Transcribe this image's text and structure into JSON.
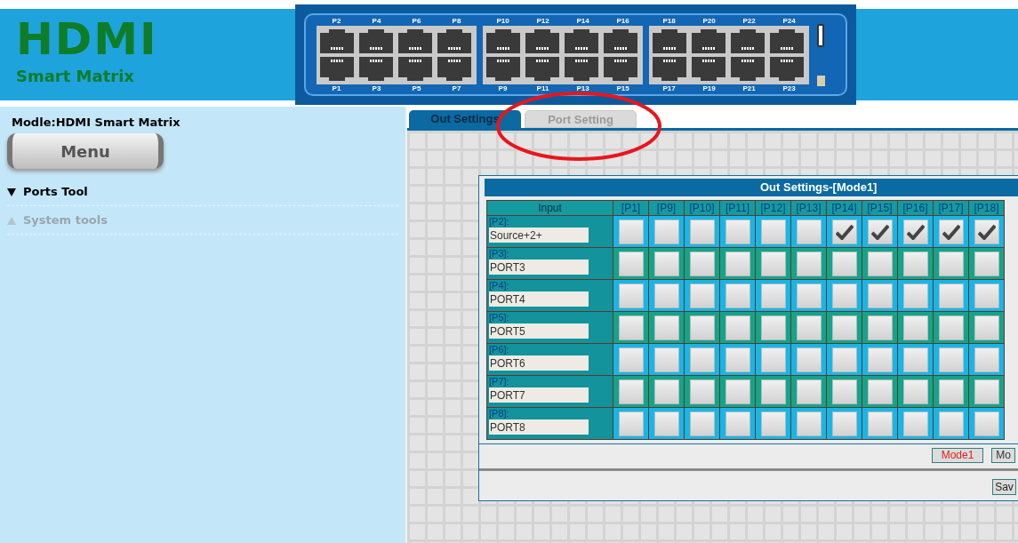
{
  "logo": {
    "title": "HDMI",
    "subtitle": "Smart Matrix"
  },
  "switch_panel": {
    "groups": [
      {
        "top_labels": [
          "P2",
          "P4",
          "P6",
          "P8"
        ],
        "bottom_labels": [
          "P1",
          "P3",
          "P5",
          "P7"
        ]
      },
      {
        "top_labels": [
          "P10",
          "P12",
          "P14",
          "P16"
        ],
        "bottom_labels": [
          "P9",
          "P11",
          "P13",
          "P15"
        ]
      },
      {
        "top_labels": [
          "P18",
          "P20",
          "P22",
          "P24"
        ],
        "bottom_labels": [
          "P17",
          "P19",
          "P21",
          "P23"
        ]
      }
    ]
  },
  "sidebar": {
    "model": "Modle:HDMI Smart Matrix",
    "menu_button": "Menu",
    "items": [
      {
        "label": "Ports Tool",
        "expanded": true
      },
      {
        "label": "System tools",
        "expanded": false
      }
    ]
  },
  "tabs": [
    {
      "label": "Out Settings",
      "selected": true
    },
    {
      "label": "Port Setting",
      "selected": false
    }
  ],
  "panel": {
    "title": "Out Settings-[Mode1]",
    "columns": [
      "Input",
      "[P1]",
      "[P9]",
      "[P10]",
      "[P11]",
      "[P12]",
      "[P13]",
      "[P14]",
      "[P15]",
      "[P16]",
      "[P17]",
      "[P18]"
    ],
    "rows": [
      {
        "port": "[P2]:",
        "name": "Source+2+",
        "checks": [
          false,
          false,
          false,
          false,
          false,
          false,
          true,
          true,
          true,
          true,
          true
        ]
      },
      {
        "port": "[P3]:",
        "name": "PORT3",
        "checks": [
          false,
          false,
          false,
          false,
          false,
          false,
          false,
          false,
          false,
          false,
          false
        ]
      },
      {
        "port": "[P4]:",
        "name": "PORT4",
        "checks": [
          false,
          false,
          false,
          false,
          false,
          false,
          false,
          false,
          false,
          false,
          false
        ]
      },
      {
        "port": "[P5]:",
        "name": "PORT5",
        "checks": [
          false,
          false,
          false,
          false,
          false,
          false,
          false,
          false,
          false,
          false,
          false
        ]
      },
      {
        "port": "[P6]:",
        "name": "PORT6",
        "checks": [
          false,
          false,
          false,
          false,
          false,
          false,
          false,
          false,
          false,
          false,
          false
        ]
      },
      {
        "port": "[P7]:",
        "name": "PORT7",
        "checks": [
          false,
          false,
          false,
          false,
          false,
          false,
          false,
          false,
          false,
          false,
          false
        ]
      },
      {
        "port": "[P8]:",
        "name": "PORT8",
        "checks": [
          false,
          false,
          false,
          false,
          false,
          false,
          false,
          false,
          false,
          false,
          false
        ]
      }
    ],
    "mode_buttons": [
      {
        "label": "Mode1",
        "selected": true
      },
      {
        "label": "Mo",
        "selected": false
      }
    ],
    "save_button": "Sav"
  }
}
